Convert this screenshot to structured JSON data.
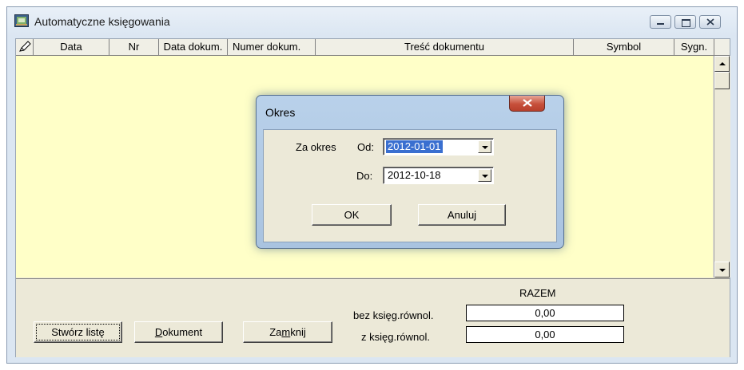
{
  "window": {
    "title": "Automatyczne księgowania",
    "icon": "ledger-app-icon",
    "controls": [
      "minimize-icon",
      "maximize-icon",
      "close-icon"
    ]
  },
  "grid": {
    "columns": [
      "Data",
      "Nr",
      "Data dokum.",
      "Numer dokum.",
      "Treść dokumentu",
      "Symbol",
      "Sygn."
    ],
    "check_column_icon": "pencil-check-icon",
    "background": "#ffffc8"
  },
  "footer": {
    "razem_label": "RAZEM",
    "bez_label": "bez księg.równol.",
    "bez_value": "0,00",
    "z_label": "z księg.równol.",
    "z_value": "0,00",
    "btn_stworz": "Stwórz listę",
    "btn_dokument_pre": "",
    "btn_dokument_acc": "D",
    "btn_dokument_post": "okument",
    "btn_zamknij_pre": "Za",
    "btn_zamknij_acc": "m",
    "btn_zamknij_post": "knij"
  },
  "dialog": {
    "title": "Okres",
    "za_okres_label": "Za okres",
    "od_label": "Od:",
    "od_value": "2012-01-01",
    "do_label": "Do:",
    "do_value": "2012-10-18",
    "ok_label": "OK",
    "cancel_label": "Anuluj",
    "selection_color": "#3a6fd0"
  }
}
